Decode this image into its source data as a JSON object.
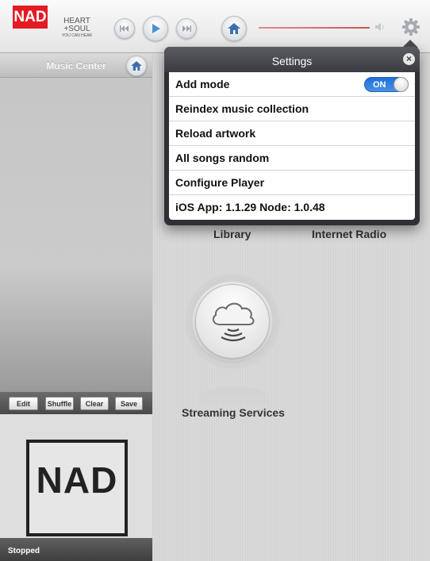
{
  "brand": {
    "logo": "NAD",
    "tagline_line1": "HEART",
    "tagline_line2": "+SOUL",
    "tagline_line3": "YOU CAN HEAR",
    "accent": "#e31b23"
  },
  "toolbar": {
    "icons": [
      "skip-back-icon",
      "play-icon",
      "skip-forward-icon",
      "home-icon",
      "volume-icon",
      "gear-icon"
    ]
  },
  "sidebar": {
    "title": "Music Center",
    "queue_buttons": [
      "Edit",
      "Shuffle",
      "Clear",
      "Save"
    ],
    "album_art_text": "NAD",
    "status": "Stopped"
  },
  "main": {
    "categories": [
      "Library",
      "Internet Radio",
      "Streaming Services"
    ]
  },
  "settings": {
    "title": "Settings",
    "items": [
      "Add mode",
      "Reindex music collection",
      "Reload artwork",
      "All songs random",
      "Configure Player",
      "iOS App: 1.1.29  Node: 1.0.48"
    ],
    "toggle_label": "ON",
    "toggle_color": "#2f7ee0"
  }
}
